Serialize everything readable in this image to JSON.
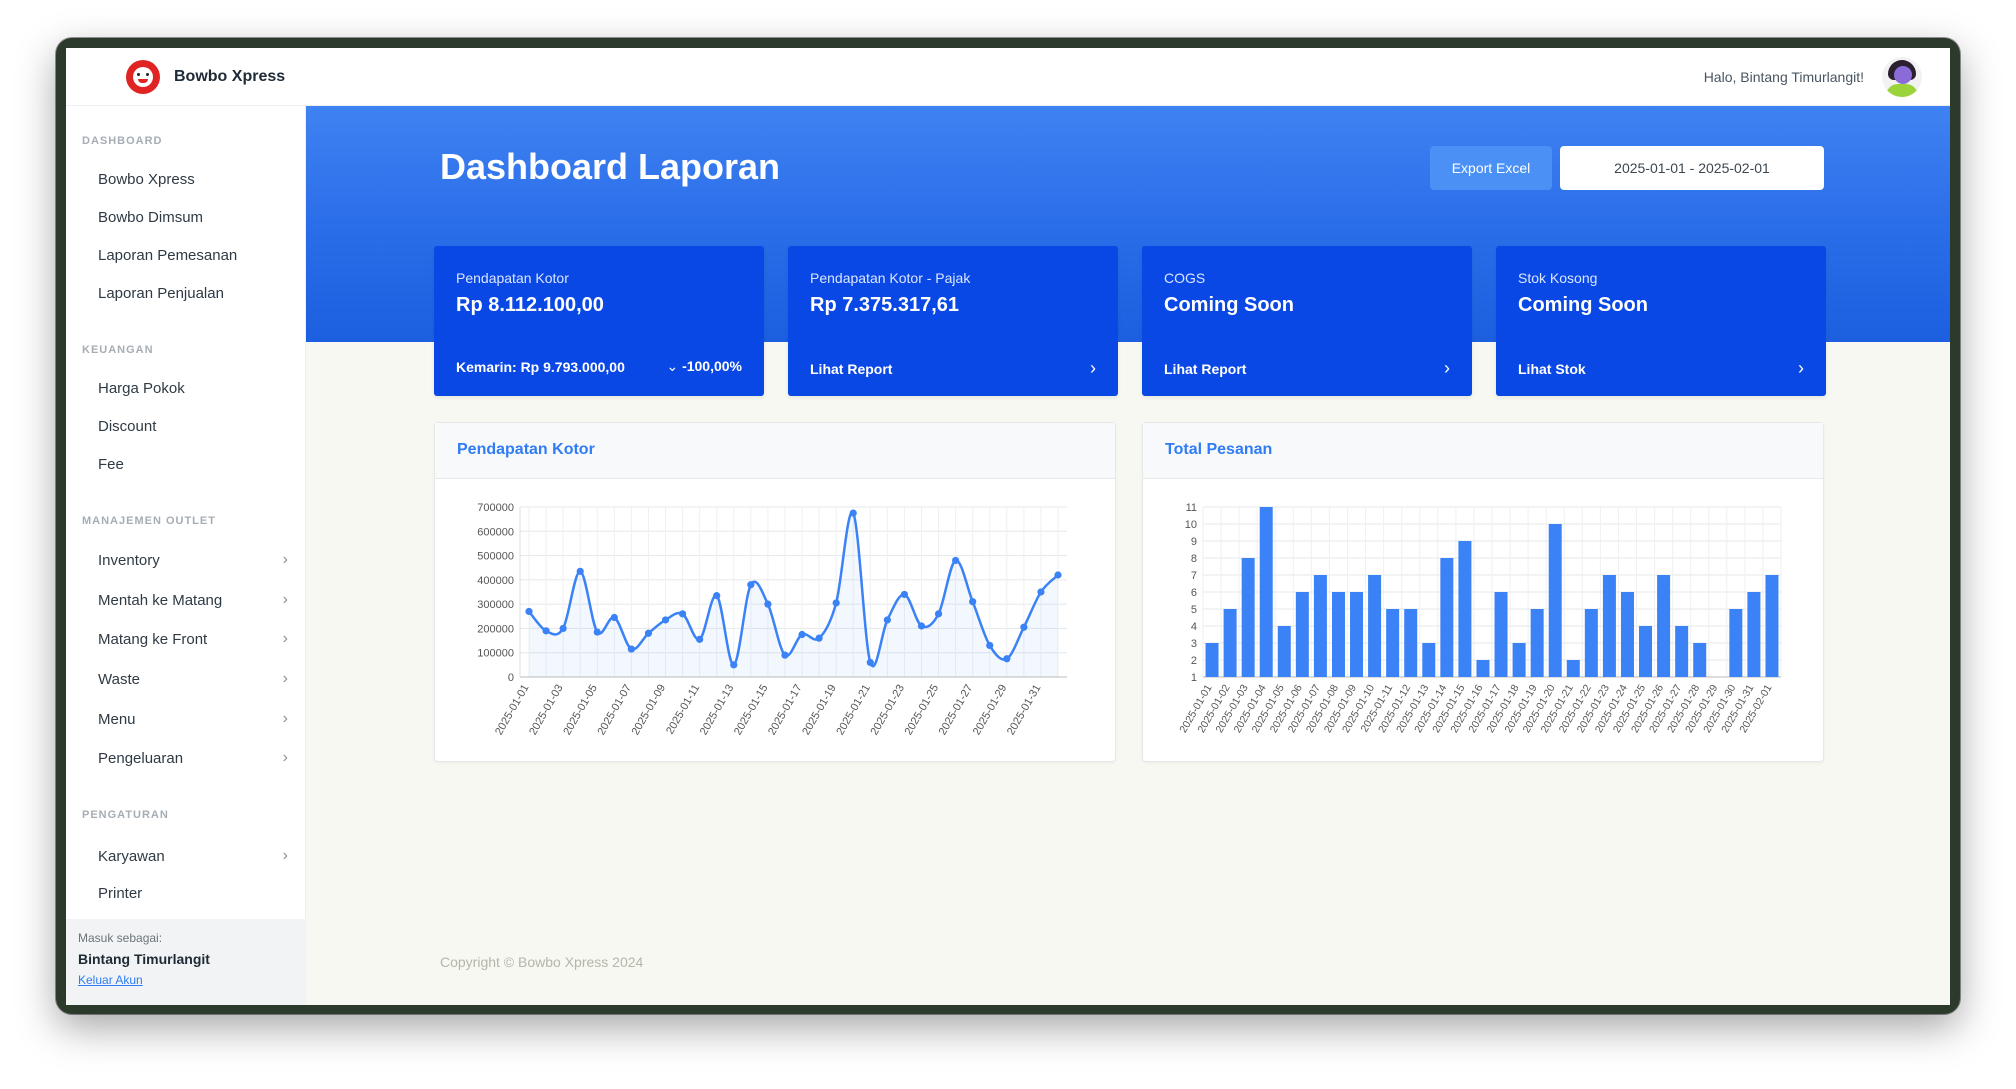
{
  "app": {
    "name": "Bowbo Xpress",
    "greeting": "Halo, Bintang Timurlangit!"
  },
  "sidebar": {
    "sections": [
      {
        "heading": "DASHBOARD",
        "items": [
          {
            "label": "Bowbo Xpress"
          },
          {
            "label": "Bowbo Dimsum"
          },
          {
            "label": "Laporan Pemesanan"
          },
          {
            "label": "Laporan Penjualan"
          }
        ]
      },
      {
        "heading": "KEUANGAN",
        "items": [
          {
            "label": "Harga Pokok"
          },
          {
            "label": "Discount"
          },
          {
            "label": "Fee"
          }
        ]
      },
      {
        "heading": "MANAJEMEN OUTLET",
        "items": [
          {
            "label": "Inventory"
          },
          {
            "label": "Mentah ke Matang"
          },
          {
            "label": "Matang ke Front"
          },
          {
            "label": "Waste"
          },
          {
            "label": "Menu"
          },
          {
            "label": "Pengeluaran"
          }
        ]
      },
      {
        "heading": "PENGATURAN",
        "items": [
          {
            "label": "Karyawan"
          },
          {
            "label": "Printer"
          }
        ]
      }
    ],
    "footer": {
      "label": "Masuk sebagai:",
      "user": "Bintang Timurlangit",
      "logout": "Keluar Akun"
    }
  },
  "header": {
    "title": "Dashboard Laporan",
    "export_label": "Export Excel",
    "date_range": "2025-01-01 - 2025-02-01"
  },
  "cards": [
    {
      "label": "Pendapatan Kotor",
      "value": "Rp 8.112.100,00",
      "foot_left": "Kemarin: Rp 9.793.000,00",
      "foot_right": "-100,00%"
    },
    {
      "label": "Pendapatan Kotor - Pajak",
      "value": "Rp 7.375.317,61",
      "foot_left": "Lihat Report"
    },
    {
      "label": "COGS",
      "value": "Coming Soon",
      "foot_left": "Lihat Report"
    },
    {
      "label": "Stok Kosong",
      "value": "Coming Soon",
      "foot_left": "Lihat Stok"
    }
  ],
  "icons": {
    "chevron": "chevron-right-icon",
    "trend_down": "chevron-down-icon"
  },
  "colors": {
    "accent": "#2f7cf6",
    "card": "#0a48e6",
    "line": "#3b82f6",
    "bar": "#3b82f6"
  },
  "footer": {
    "copyright": "Copyright © Bowbo Xpress 2024"
  },
  "chart_data": [
    {
      "type": "line",
      "title": "Pendapatan Kotor",
      "x": [
        "2025-01-01",
        "2025-01-02",
        "2025-01-03",
        "2025-01-04",
        "2025-01-05",
        "2025-01-06",
        "2025-01-07",
        "2025-01-08",
        "2025-01-09",
        "2025-01-10",
        "2025-01-11",
        "2025-01-12",
        "2025-01-13",
        "2025-01-14",
        "2025-01-15",
        "2025-01-16",
        "2025-01-17",
        "2025-01-18",
        "2025-01-19",
        "2025-01-20",
        "2025-01-21",
        "2025-01-22",
        "2025-01-23",
        "2025-01-24",
        "2025-01-25",
        "2025-01-26",
        "2025-01-27",
        "2025-01-28",
        "2025-01-29",
        "2025-01-30",
        "2025-01-31",
        "2025-02-01"
      ],
      "x_tick_labels": [
        "2025-01-01",
        "2025-01-03",
        "2025-01-05",
        "2025-01-07",
        "2025-01-09",
        "2025-01-11",
        "2025-01-13",
        "2025-01-15",
        "2025-01-17",
        "2025-01-19",
        "2025-01-21",
        "2025-01-23",
        "2025-01-25",
        "2025-01-27",
        "2025-01-29",
        "2025-01-31"
      ],
      "values": [
        270000,
        190000,
        200000,
        435000,
        185000,
        245000,
        115000,
        180000,
        235000,
        260000,
        155000,
        335000,
        50000,
        380000,
        300000,
        90000,
        175000,
        160000,
        305000,
        675000,
        60000,
        235000,
        340000,
        210000,
        260000,
        480000,
        310000,
        130000,
        75000,
        205000,
        350000,
        420000
      ],
      "ylim": [
        0,
        700000
      ],
      "yticks": [
        0,
        100000,
        200000,
        300000,
        400000,
        500000,
        600000,
        700000
      ],
      "grid": true
    },
    {
      "type": "bar",
      "title": "Total Pesanan",
      "categories": [
        "2025-01-01",
        "2025-01-02",
        "2025-01-03",
        "2025-01-04",
        "2025-01-05",
        "2025-01-06",
        "2025-01-07",
        "2025-01-08",
        "2025-01-09",
        "2025-01-10",
        "2025-01-11",
        "2025-01-12",
        "2025-01-13",
        "2025-01-14",
        "2025-01-15",
        "2025-01-16",
        "2025-01-17",
        "2025-01-18",
        "2025-01-19",
        "2025-01-20",
        "2025-01-21",
        "2025-01-22",
        "2025-01-23",
        "2025-01-24",
        "2025-01-25",
        "2025-01-26",
        "2025-01-27",
        "2025-01-28",
        "2025-01-29",
        "2025-01-30",
        "2025-01-31",
        "2025-02-01"
      ],
      "values": [
        3,
        5,
        8,
        11,
        4,
        6,
        7,
        6,
        6,
        7,
        5,
        5,
        3,
        8,
        9,
        2,
        6,
        3,
        5,
        10,
        2,
        5,
        7,
        6,
        4,
        7,
        4,
        3,
        1,
        5,
        6,
        7
      ],
      "ylim": [
        1,
        11
      ],
      "yticks": [
        1,
        2,
        3,
        4,
        5,
        6,
        7,
        8,
        9,
        10,
        11
      ],
      "grid": true
    }
  ]
}
